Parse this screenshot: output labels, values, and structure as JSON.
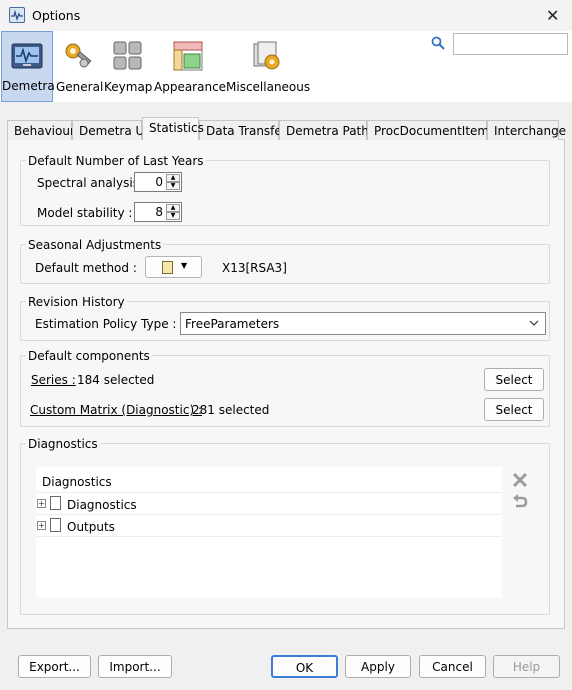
{
  "window": {
    "title": "Options"
  },
  "categories": [
    {
      "label": "Demetra",
      "selected": true
    },
    {
      "label": "General"
    },
    {
      "label": "Keymap"
    },
    {
      "label": "Appearance"
    },
    {
      "label": "Miscellaneous"
    }
  ],
  "search": {
    "placeholder": ""
  },
  "tabs": [
    "Behaviour",
    "Demetra UI",
    "Statistics",
    "Data Transfer",
    "Demetra Paths",
    "ProcDocumentItems",
    "Interchange"
  ],
  "selected_tab": "Statistics",
  "last_years": {
    "title": "Default Number of Last Years",
    "spectral_label": "Spectral analysis :",
    "spectral_value": "0",
    "model_label": "Model stability :",
    "model_value": "8"
  },
  "seasonal": {
    "title": "Seasonal Adjustments",
    "method_label": "Default method :",
    "method_value": "X13[RSA3]"
  },
  "revision": {
    "title": "Revision History",
    "policy_label": "Estimation Policy Type :",
    "policy_value": "FreeParameters"
  },
  "components": {
    "title": "Default components",
    "series_link": "Series :",
    "series_count": "184 selected",
    "matrix_link": "Custom Matrix (Diagnostic) :",
    "matrix_count": "281 selected",
    "select_label": "Select"
  },
  "diagnostics": {
    "title": "Diagnostics",
    "header": "Diagnostics",
    "items": [
      "Diagnostics",
      "Outputs"
    ]
  },
  "footer": {
    "export": "Export...",
    "import": "Import...",
    "ok": "OK",
    "apply": "Apply",
    "cancel": "Cancel",
    "help": "Help"
  },
  "colors": {
    "selected_category": "#c8d8ef",
    "accent": "#3f7bd8"
  }
}
